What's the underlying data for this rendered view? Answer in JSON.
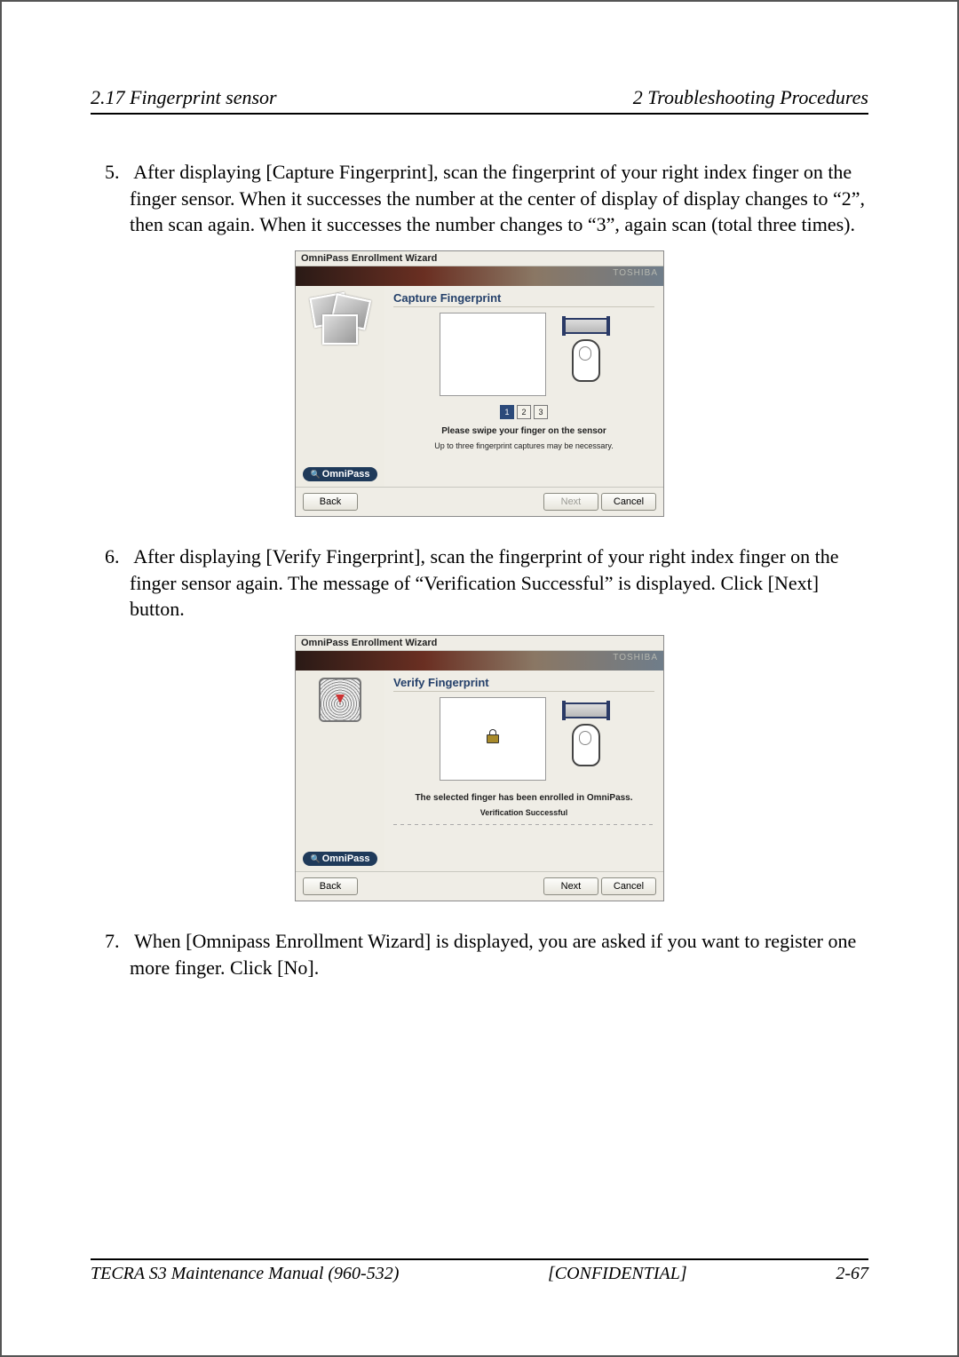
{
  "header": {
    "left": "2.17 Fingerprint sensor",
    "right": "2  Troubleshooting Procedures"
  },
  "steps": {
    "s5": {
      "num": "5.",
      "text": "After displaying [Capture Fingerprint], scan the fingerprint of your right index finger on the finger sensor. When it successes the number at the center of display of display changes to “2”, then scan again. When it successes the number changes to “3”, again scan (total three times)."
    },
    "s6": {
      "num": "6.",
      "text": "After displaying [Verify Fingerprint], scan the fingerprint of your right index finger on the finger sensor again. The message of “Verification Successful” is displayed. Click [Next] button."
    },
    "s7": {
      "num": "7.",
      "text": "When [Omnipass Enrollment Wizard] is displayed, you are asked if you want to register one more finger. Click [No]."
    }
  },
  "wizard_common": {
    "title": "OmniPass Enrollment Wizard",
    "brand_banner": "TOSHIBA",
    "badge": "OmniPass",
    "back": "Back",
    "next": "Next",
    "cancel": "Cancel"
  },
  "wizard1": {
    "heading": "Capture Fingerprint",
    "counters": [
      "1",
      "2",
      "3"
    ],
    "active_counter_index": 0,
    "msg": "Please swipe your finger on the sensor",
    "sub": "Up to three fingerprint captures may be necessary.",
    "next_enabled": false
  },
  "wizard2": {
    "heading": "Verify Fingerprint",
    "msg": "The selected finger has been enrolled in OmniPass.",
    "sub": "Verification Successful",
    "next_enabled": true
  },
  "footer": {
    "left": "TECRA S3 Maintenance Manual (960-532)",
    "center": "[CONFIDENTIAL]",
    "right": "2-67"
  }
}
